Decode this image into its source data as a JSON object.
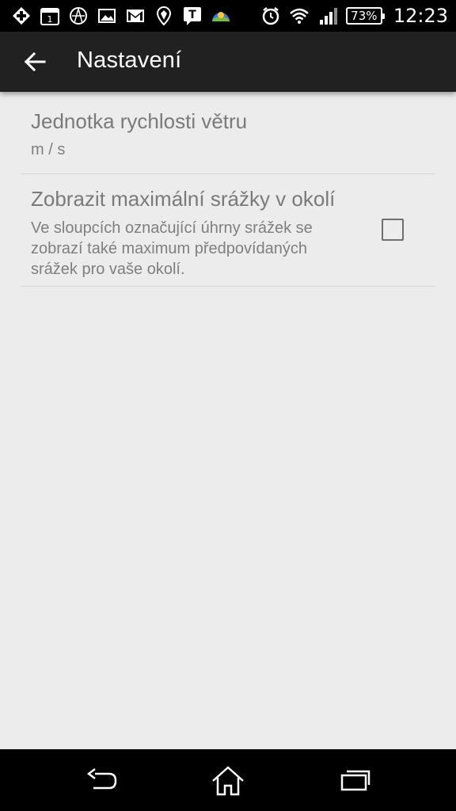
{
  "status_bar": {
    "battery_percent": "73%",
    "time": "12:23",
    "left_icons": [
      "medical-plus-icon",
      "calendar-icon",
      "android-icon",
      "image-icon",
      "gmail-icon",
      "maps-icon",
      "text-badge-icon",
      "weather-icon"
    ],
    "right_icons": [
      "alarm-icon",
      "wifi-icon",
      "signal-icon"
    ],
    "calendar_day": "1",
    "text_badge": "T"
  },
  "action_bar": {
    "title": "Nastavení"
  },
  "preferences": [
    {
      "title": "Jednotka rychlosti větru",
      "summary": "m / s"
    },
    {
      "title": "Zobrazit maximální srážky v okolí",
      "summary": "Ve sloupcích označující úhrny srážek se zobrazí také maximum předpovídaných srážek pro vaše okolí.",
      "checked": false
    }
  ],
  "colors": {
    "background": "#ececec",
    "action_bar": "#212121",
    "text_gray": "#7a7a7a"
  }
}
